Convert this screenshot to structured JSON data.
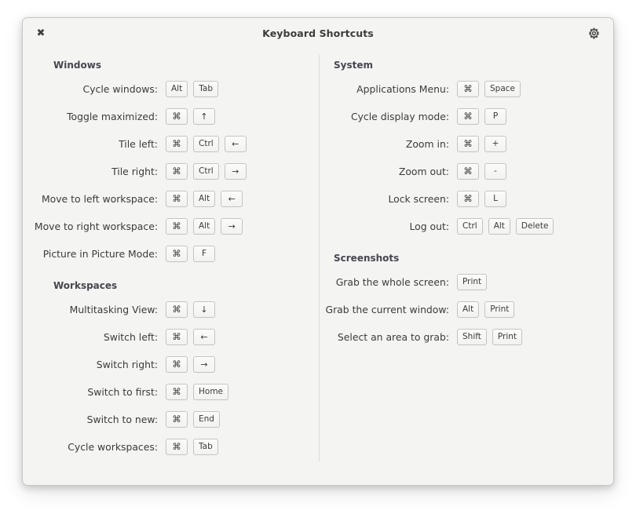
{
  "window": {
    "title": "Keyboard Shortcuts",
    "close_label": "✖",
    "close_icon": "close-icon",
    "settings_icon": "gear-icon"
  },
  "columns": [
    {
      "name": "left",
      "sections": [
        {
          "title": "Windows",
          "rows": [
            {
              "label": "Cycle windows:",
              "keys": [
                "Alt",
                "Tab"
              ]
            },
            {
              "label": "Toggle maximized:",
              "keys": [
                "⌘",
                "↑"
              ]
            },
            {
              "label": "Tile left:",
              "keys": [
                "⌘",
                "Ctrl",
                "←"
              ]
            },
            {
              "label": "Tile right:",
              "keys": [
                "⌘",
                "Ctrl",
                "→"
              ]
            },
            {
              "label": "Move to left workspace:",
              "keys": [
                "⌘",
                "Alt",
                "←"
              ]
            },
            {
              "label": "Move to right workspace:",
              "keys": [
                "⌘",
                "Alt",
                "→"
              ]
            },
            {
              "label": "Picture in Picture Mode:",
              "keys": [
                "⌘",
                "F"
              ]
            }
          ]
        },
        {
          "title": "Workspaces",
          "rows": [
            {
              "label": "Multitasking View:",
              "keys": [
                "⌘",
                "↓"
              ]
            },
            {
              "label": "Switch left:",
              "keys": [
                "⌘",
                "←"
              ]
            },
            {
              "label": "Switch right:",
              "keys": [
                "⌘",
                "→"
              ]
            },
            {
              "label": "Switch to first:",
              "keys": [
                "⌘",
                "Home"
              ]
            },
            {
              "label": "Switch to new:",
              "keys": [
                "⌘",
                "End"
              ]
            },
            {
              "label": "Cycle workspaces:",
              "keys": [
                "⌘",
                "Tab"
              ]
            }
          ]
        }
      ]
    },
    {
      "name": "right",
      "sections": [
        {
          "title": "System",
          "rows": [
            {
              "label": "Applications Menu:",
              "keys": [
                "⌘",
                "Space"
              ]
            },
            {
              "label": "Cycle display mode:",
              "keys": [
                "⌘",
                "P"
              ]
            },
            {
              "label": "Zoom in:",
              "keys": [
                "⌘",
                "+"
              ]
            },
            {
              "label": "Zoom out:",
              "keys": [
                "⌘",
                "-"
              ]
            },
            {
              "label": "Lock screen:",
              "keys": [
                "⌘",
                "L"
              ]
            },
            {
              "label": "Log out:",
              "keys": [
                "Ctrl",
                "Alt",
                "Delete"
              ]
            }
          ]
        },
        {
          "title": "Screenshots",
          "rows": [
            {
              "label": "Grab the whole screen:",
              "keys": [
                "Print"
              ]
            },
            {
              "label": "Grab the current window:",
              "keys": [
                "Alt",
                "Print"
              ]
            },
            {
              "label": "Select an area to grab:",
              "keys": [
                "Shift",
                "Print"
              ]
            }
          ]
        }
      ]
    }
  ]
}
